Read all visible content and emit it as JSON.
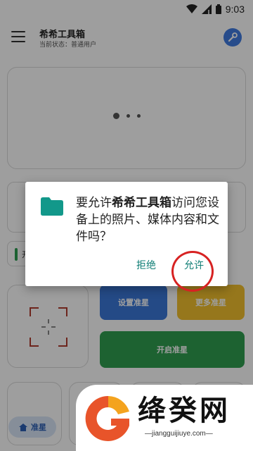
{
  "status_bar": {
    "time": "9:03"
  },
  "app_bar": {
    "title": "希希工具箱",
    "subtitle": "当前状态：普通用户"
  },
  "main": {
    "toggle_label": "开",
    "buttons": {
      "set_crosshair": "设置准星",
      "more_crosshair": "更多准星",
      "open_crosshair": "开启准星"
    },
    "fab_label": "准星"
  },
  "dialog": {
    "message_prefix": "要允许",
    "app_name": "希希工具箱",
    "message_suffix": "访问您设备上的照片、媒体内容和文件吗？",
    "deny_label": "拒绝",
    "allow_label": "允许"
  },
  "watermark": {
    "brand": "绛癸网",
    "url": "—jiangguijiuye.com—"
  },
  "colors": {
    "accent_teal": "#0d7d74",
    "blue": "#3b78d8",
    "yellow": "#f2c12e",
    "green": "#2f9e4f",
    "annotation_red": "#d72222"
  },
  "icons": [
    "wifi-icon",
    "signal-icon",
    "battery-icon",
    "menu-icon",
    "wrench-icon",
    "crosshair-icon",
    "home-icon",
    "folder-icon"
  ]
}
